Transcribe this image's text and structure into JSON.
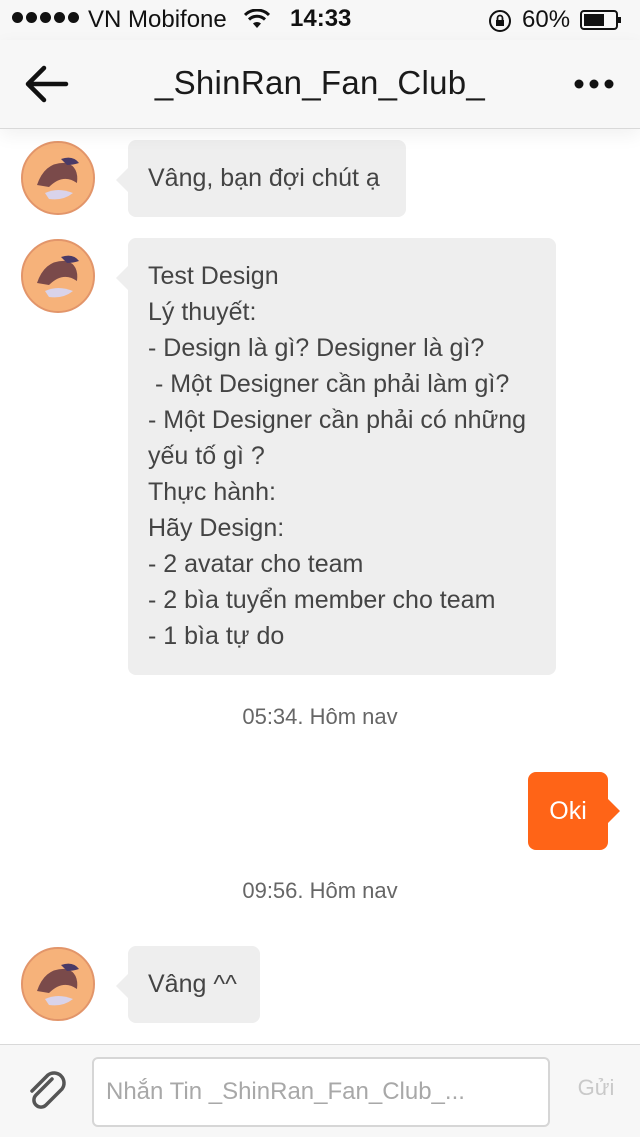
{
  "status_bar": {
    "carrier": "VN Mobifone",
    "time": "14:33",
    "battery": "60%",
    "icons": [
      "signal-dots-icon",
      "wifi-icon",
      "rotation-lock-icon",
      "battery-icon"
    ]
  },
  "header": {
    "title": "_ShinRan_Fan_Club_",
    "back_icon": "arrow-left-icon",
    "more_icon": "more-dots-icon"
  },
  "messages": [
    {
      "direction": "incoming",
      "lines": [
        "Vâng, bạn đợi chút ạ"
      ]
    },
    {
      "direction": "incoming",
      "lines": [
        "Test Design",
        "Lý thuyết:",
        "- Design là gì? Designer là gì?",
        " - Một Designer cần phải làm gì?",
        "- Một Designer cần phải có những",
        "yếu tố gì ?",
        "Thực hành:",
        "Hãy Design:",
        "- 2 avatar cho team",
        "- 2 bìa tuyển member cho team",
        "- 1 bìa tự do"
      ]
    },
    {
      "direction": "timestamp",
      "text": "05:34. Hôm nav"
    },
    {
      "direction": "outgoing",
      "text": "Oki"
    },
    {
      "direction": "timestamp",
      "text": "09:56. Hôm nav"
    },
    {
      "direction": "incoming",
      "lines": [
        "Vâng ^^"
      ]
    }
  ],
  "composer": {
    "placeholder": "Nhắn Tin _ShinRan_Fan_Club_...",
    "send_label": "Gửi",
    "attach_icon": "paperclip-icon"
  },
  "colors": {
    "accent": "#ff6417",
    "incoming_bubble": "#eeeeee",
    "bar_background": "#f7f7f7",
    "avatar": "#f6b27a"
  }
}
